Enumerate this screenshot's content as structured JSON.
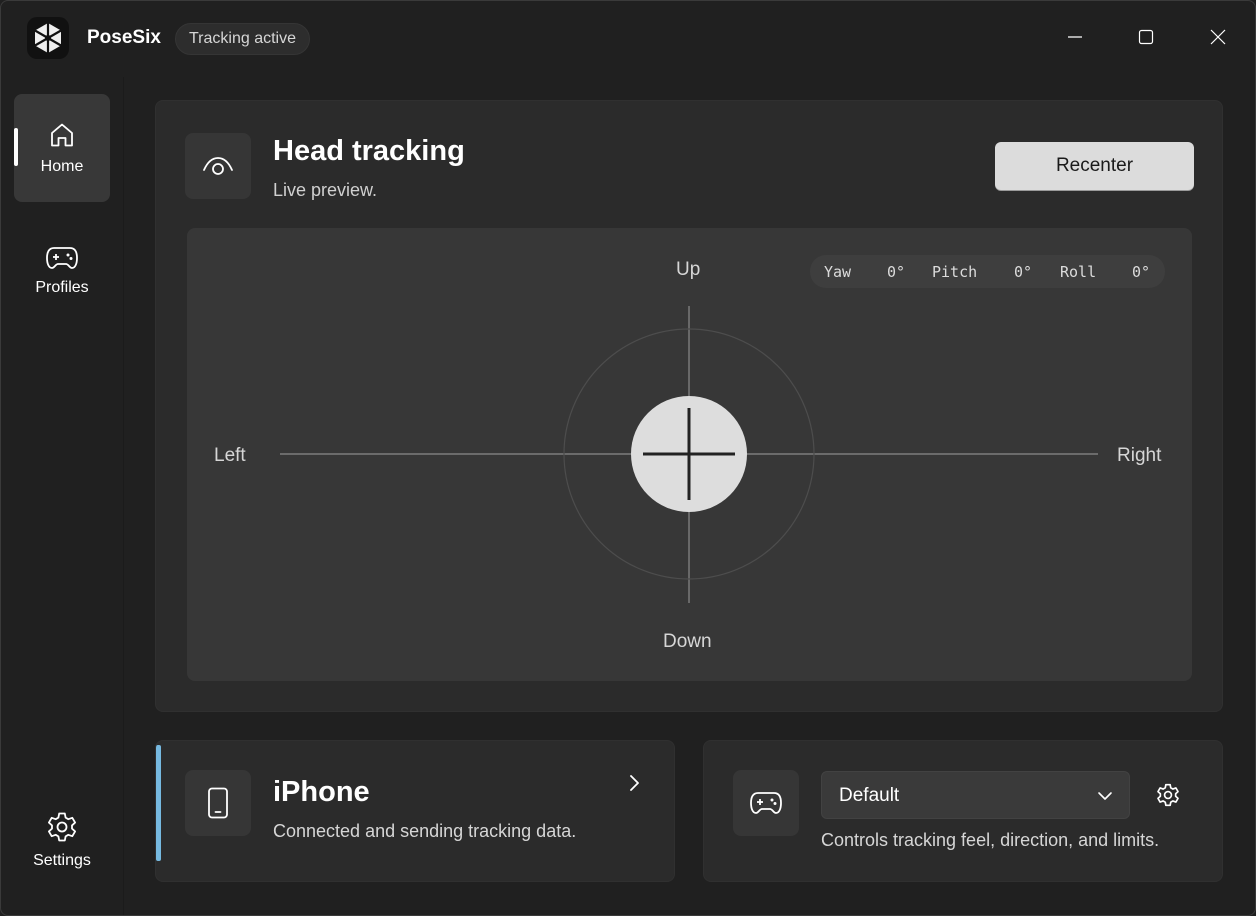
{
  "app": {
    "title": "PoseSix",
    "status": "Tracking active"
  },
  "sidebar": {
    "items": [
      {
        "label": "Home",
        "icon": "home-icon",
        "active": true
      },
      {
        "label": "Profiles",
        "icon": "gamepad-icon",
        "active": false
      }
    ],
    "footer": {
      "label": "Settings",
      "icon": "gear-icon"
    }
  },
  "head_tracking": {
    "title": "Head tracking",
    "subtitle": "Live preview.",
    "recenter_label": "Recenter",
    "icon": "eye-icon",
    "directions": {
      "up": "Up",
      "down": "Down",
      "left": "Left",
      "right": "Right"
    },
    "readout": {
      "yaw_label": "Yaw",
      "yaw_value": "0°",
      "pitch_label": "Pitch",
      "pitch_value": "0°",
      "roll_label": "Roll",
      "roll_value": "0°"
    }
  },
  "device": {
    "name": "iPhone",
    "status": "Connected and sending tracking data.",
    "icon": "phone-icon",
    "accent_color": "#76b9e0"
  },
  "profile": {
    "selected": "Default",
    "description": "Controls tracking feel, direction, and limits.",
    "icon": "gamepad-icon"
  },
  "colors": {
    "background": "#202020",
    "card": "#2b2b2b",
    "preview": "#373737",
    "accent": "#76b9e0"
  }
}
